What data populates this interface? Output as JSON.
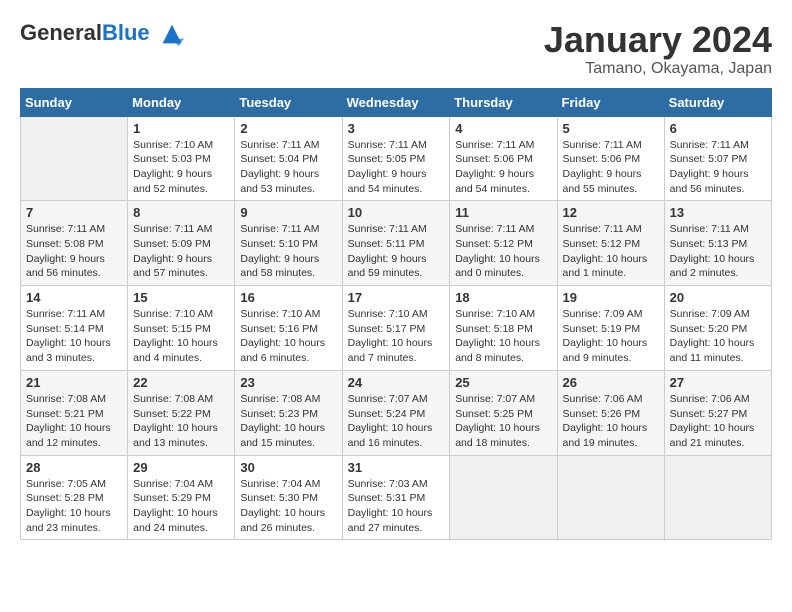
{
  "logo": {
    "text_general": "General",
    "text_blue": "Blue"
  },
  "header": {
    "month_year": "January 2024",
    "location": "Tamano, Okayama, Japan"
  },
  "columns": [
    "Sunday",
    "Monday",
    "Tuesday",
    "Wednesday",
    "Thursday",
    "Friday",
    "Saturday"
  ],
  "weeks": [
    {
      "days": [
        {
          "num": "",
          "content": ""
        },
        {
          "num": "1",
          "content": "Sunrise: 7:10 AM\nSunset: 5:03 PM\nDaylight: 9 hours and 52 minutes."
        },
        {
          "num": "2",
          "content": "Sunrise: 7:11 AM\nSunset: 5:04 PM\nDaylight: 9 hours and 53 minutes."
        },
        {
          "num": "3",
          "content": "Sunrise: 7:11 AM\nSunset: 5:05 PM\nDaylight: 9 hours and 54 minutes."
        },
        {
          "num": "4",
          "content": "Sunrise: 7:11 AM\nSunset: 5:06 PM\nDaylight: 9 hours and 54 minutes."
        },
        {
          "num": "5",
          "content": "Sunrise: 7:11 AM\nSunset: 5:06 PM\nDaylight: 9 hours and 55 minutes."
        },
        {
          "num": "6",
          "content": "Sunrise: 7:11 AM\nSunset: 5:07 PM\nDaylight: 9 hours and 56 minutes."
        }
      ]
    },
    {
      "days": [
        {
          "num": "7",
          "content": "Sunrise: 7:11 AM\nSunset: 5:08 PM\nDaylight: 9 hours and 56 minutes."
        },
        {
          "num": "8",
          "content": "Sunrise: 7:11 AM\nSunset: 5:09 PM\nDaylight: 9 hours and 57 minutes."
        },
        {
          "num": "9",
          "content": "Sunrise: 7:11 AM\nSunset: 5:10 PM\nDaylight: 9 hours and 58 minutes."
        },
        {
          "num": "10",
          "content": "Sunrise: 7:11 AM\nSunset: 5:11 PM\nDaylight: 9 hours and 59 minutes."
        },
        {
          "num": "11",
          "content": "Sunrise: 7:11 AM\nSunset: 5:12 PM\nDaylight: 10 hours and 0 minutes."
        },
        {
          "num": "12",
          "content": "Sunrise: 7:11 AM\nSunset: 5:12 PM\nDaylight: 10 hours and 1 minute."
        },
        {
          "num": "13",
          "content": "Sunrise: 7:11 AM\nSunset: 5:13 PM\nDaylight: 10 hours and 2 minutes."
        }
      ]
    },
    {
      "days": [
        {
          "num": "14",
          "content": "Sunrise: 7:11 AM\nSunset: 5:14 PM\nDaylight: 10 hours and 3 minutes."
        },
        {
          "num": "15",
          "content": "Sunrise: 7:10 AM\nSunset: 5:15 PM\nDaylight: 10 hours and 4 minutes."
        },
        {
          "num": "16",
          "content": "Sunrise: 7:10 AM\nSunset: 5:16 PM\nDaylight: 10 hours and 6 minutes."
        },
        {
          "num": "17",
          "content": "Sunrise: 7:10 AM\nSunset: 5:17 PM\nDaylight: 10 hours and 7 minutes."
        },
        {
          "num": "18",
          "content": "Sunrise: 7:10 AM\nSunset: 5:18 PM\nDaylight: 10 hours and 8 minutes."
        },
        {
          "num": "19",
          "content": "Sunrise: 7:09 AM\nSunset: 5:19 PM\nDaylight: 10 hours and 9 minutes."
        },
        {
          "num": "20",
          "content": "Sunrise: 7:09 AM\nSunset: 5:20 PM\nDaylight: 10 hours and 11 minutes."
        }
      ]
    },
    {
      "days": [
        {
          "num": "21",
          "content": "Sunrise: 7:08 AM\nSunset: 5:21 PM\nDaylight: 10 hours and 12 minutes."
        },
        {
          "num": "22",
          "content": "Sunrise: 7:08 AM\nSunset: 5:22 PM\nDaylight: 10 hours and 13 minutes."
        },
        {
          "num": "23",
          "content": "Sunrise: 7:08 AM\nSunset: 5:23 PM\nDaylight: 10 hours and 15 minutes."
        },
        {
          "num": "24",
          "content": "Sunrise: 7:07 AM\nSunset: 5:24 PM\nDaylight: 10 hours and 16 minutes."
        },
        {
          "num": "25",
          "content": "Sunrise: 7:07 AM\nSunset: 5:25 PM\nDaylight: 10 hours and 18 minutes."
        },
        {
          "num": "26",
          "content": "Sunrise: 7:06 AM\nSunset: 5:26 PM\nDaylight: 10 hours and 19 minutes."
        },
        {
          "num": "27",
          "content": "Sunrise: 7:06 AM\nSunset: 5:27 PM\nDaylight: 10 hours and 21 minutes."
        }
      ]
    },
    {
      "days": [
        {
          "num": "28",
          "content": "Sunrise: 7:05 AM\nSunset: 5:28 PM\nDaylight: 10 hours and 23 minutes."
        },
        {
          "num": "29",
          "content": "Sunrise: 7:04 AM\nSunset: 5:29 PM\nDaylight: 10 hours and 24 minutes."
        },
        {
          "num": "30",
          "content": "Sunrise: 7:04 AM\nSunset: 5:30 PM\nDaylight: 10 hours and 26 minutes."
        },
        {
          "num": "31",
          "content": "Sunrise: 7:03 AM\nSunset: 5:31 PM\nDaylight: 10 hours and 27 minutes."
        },
        {
          "num": "",
          "content": ""
        },
        {
          "num": "",
          "content": ""
        },
        {
          "num": "",
          "content": ""
        }
      ]
    }
  ]
}
